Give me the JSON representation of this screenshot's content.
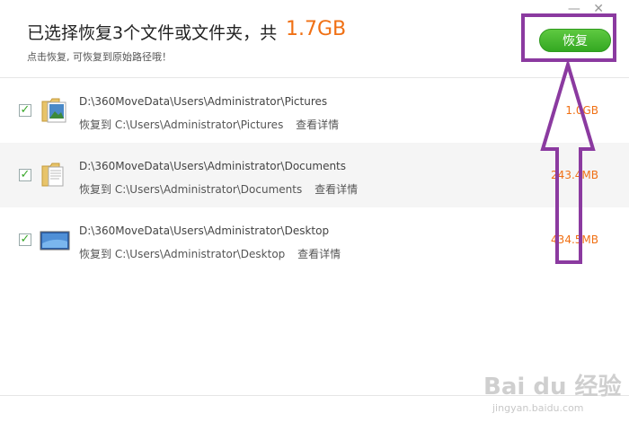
{
  "header": {
    "title": "已选择恢复3个文件或文件夹，共",
    "total_size": "1.7GB",
    "subtitle": "点击恢复, 可恢复到原始路径哦！",
    "restore_label": "恢复",
    "window_controls": {
      "minimize": "—",
      "close": "✕"
    }
  },
  "items": [
    {
      "path": "D:\\360MoveData\\Users\\Administrator\\Pictures",
      "restore_prefix": "恢复到",
      "restore_to": "C:\\Users\\Administrator\\Pictures",
      "details_label": "查看详情",
      "size": "1.0GB",
      "checked": true,
      "icon": "picture-folder-icon"
    },
    {
      "path": "D:\\360MoveData\\Users\\Administrator\\Documents",
      "restore_prefix": "恢复到",
      "restore_to": "C:\\Users\\Administrator\\Documents",
      "details_label": "查看详情",
      "size": "243.4MB",
      "checked": true,
      "icon": "document-folder-icon"
    },
    {
      "path": "D:\\360MoveData\\Users\\Administrator\\Desktop",
      "restore_prefix": "恢复到",
      "restore_to": "C:\\Users\\Administrator\\Desktop",
      "details_label": "查看详情",
      "size": "434.5MB",
      "checked": true,
      "icon": "desktop-icon"
    }
  ],
  "watermark": {
    "text": "Bai du 经验",
    "sub": "jingyan.baidu.com"
  },
  "colors": {
    "accent": "#f07014",
    "button_green": "#3db22a",
    "annotation_purple": "#8b3aa0"
  }
}
